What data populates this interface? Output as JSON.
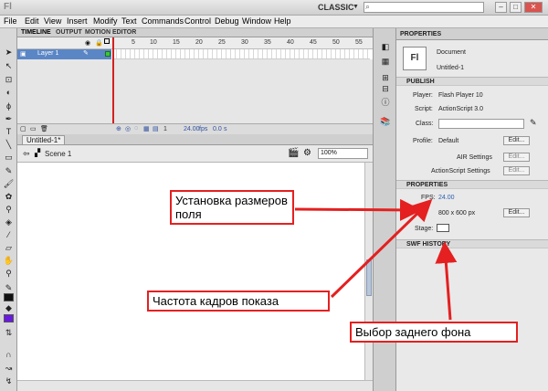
{
  "app": {
    "logo": "Fl",
    "workspace": "CLASSIC"
  },
  "menu": [
    "File",
    "Edit",
    "View",
    "Insert",
    "Modify",
    "Text",
    "Commands",
    "Control",
    "Debug",
    "Window",
    "Help"
  ],
  "timeline": {
    "tabs": [
      "TIMELINE",
      "OUTPUT",
      "MOTION EDITOR"
    ],
    "frame_numbers": [
      "5",
      "10",
      "15",
      "20",
      "25",
      "30",
      "35",
      "40",
      "45",
      "50",
      "55"
    ],
    "layer_name": "Layer 1",
    "footer_frame": "1",
    "footer_fps": "24.00",
    "footer_fps_unit": "fps",
    "footer_time": "0.0",
    "footer_time_unit": "s"
  },
  "document": {
    "tab": "Untitled-1*",
    "scene": "Scene 1",
    "zoom": "100%"
  },
  "properties": {
    "tab": "PROPERTIES",
    "doc_type": "Document",
    "doc_name": "Untitled-1",
    "publish_section": "PUBLISH",
    "player_label": "Player:",
    "player_value": "Flash Player 10",
    "script_label": "Script:",
    "script_value": "ActionScript 3.0",
    "class_label": "Class:",
    "profile_label": "Profile:",
    "profile_value": "Default",
    "edit_label": "Edit...",
    "air_settings": "AIR Settings",
    "as_settings": "ActionScript Settings",
    "properties_section": "PROPERTIES",
    "fps_label": "FPS:",
    "fps_value": "24.00",
    "size_value": "800 x 600 px",
    "stage_label": "Stage:",
    "swf_section": "SWF HISTORY"
  },
  "callouts": {
    "stage_size": "Установка размеров поля",
    "frame_rate": "Частота кадров показа",
    "bg_color": "Выбор заднего фона"
  },
  "colors": {
    "accent_red": "#e42020",
    "layer_blue": "#5a86c6",
    "link_blue": "#2a5fb0"
  }
}
